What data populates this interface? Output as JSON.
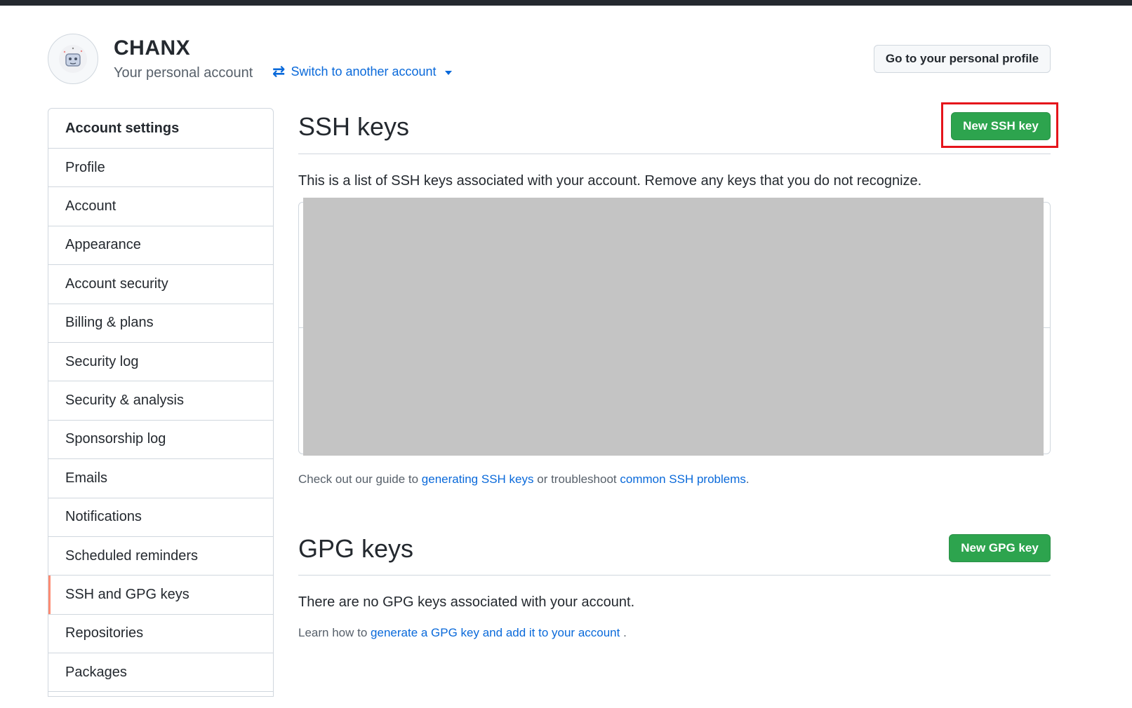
{
  "header": {
    "username": "CHANX",
    "subtitle": "Your personal account",
    "switch_label": "Switch to another account",
    "profile_button": "Go to your personal profile"
  },
  "sidebar": {
    "title": "Account settings",
    "items": [
      {
        "label": "Profile"
      },
      {
        "label": "Account"
      },
      {
        "label": "Appearance"
      },
      {
        "label": "Account security"
      },
      {
        "label": "Billing & plans"
      },
      {
        "label": "Security log"
      },
      {
        "label": "Security & analysis"
      },
      {
        "label": "Sponsorship log"
      },
      {
        "label": "Emails"
      },
      {
        "label": "Notifications"
      },
      {
        "label": "Scheduled reminders"
      },
      {
        "label": "SSH and GPG keys",
        "active": true
      },
      {
        "label": "Repositories"
      },
      {
        "label": "Packages"
      }
    ]
  },
  "ssh": {
    "title": "SSH keys",
    "new_button": "New SSH key",
    "description": "This is a list of SSH keys associated with your account. Remove any keys that you do not recognize.",
    "guide_prefix": "Check out our guide to",
    "guide_link": "generating SSH keys",
    "guide_mid": "or troubleshoot",
    "problems_link": "common SSH problems",
    "guide_suffix": "."
  },
  "gpg": {
    "title": "GPG keys",
    "new_button": "New GPG key",
    "empty_text": "There are no GPG keys associated with your account.",
    "learn_prefix": "Learn how to",
    "learn_link": "generate a GPG key and add it to your account",
    "learn_suffix": "."
  },
  "colors": {
    "accent_green": "#2da44e",
    "link_blue": "#0969da",
    "active_marker": "#fd8c73",
    "highlight_red": "#e5141b",
    "redacted_gray": "#c4c4c4"
  }
}
